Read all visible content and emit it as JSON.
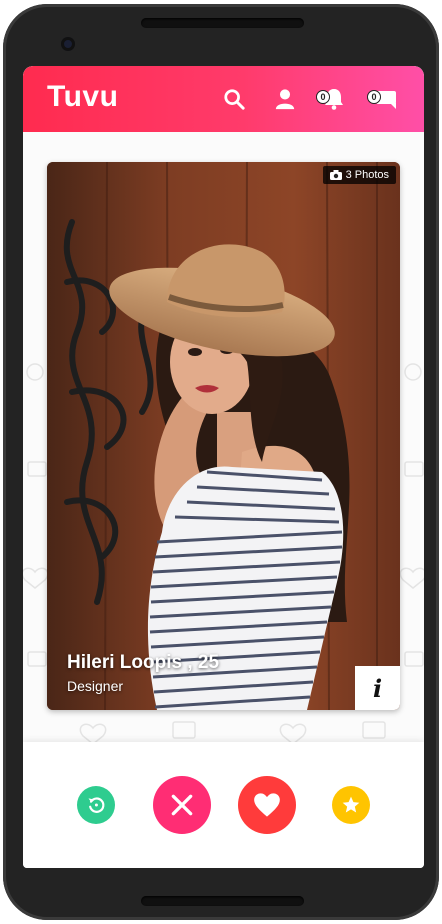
{
  "app": {
    "name": "Tuvu"
  },
  "header": {
    "notifications_count": "0",
    "messages_count": "0"
  },
  "profile": {
    "photo_count_label": "3 Photos",
    "name_age": "Hileri Loopis , 25",
    "occupation": "Designer",
    "info_label": "i"
  },
  "colors": {
    "header_gradient_start": "#ff2b4f",
    "header_gradient_end": "#ff4fa7",
    "rewind": "#2ecc8f",
    "nope": "#ff2d74",
    "like": "#ff3b3b",
    "superlike": "#ffc400"
  },
  "icons": {
    "search": "search-icon",
    "profile": "user-icon",
    "notifications": "bell-icon",
    "messages": "chat-icon",
    "camera": "camera-icon",
    "rewind": "rewind-icon",
    "nope": "close-icon",
    "like": "heart-icon",
    "superlike": "star-icon"
  }
}
